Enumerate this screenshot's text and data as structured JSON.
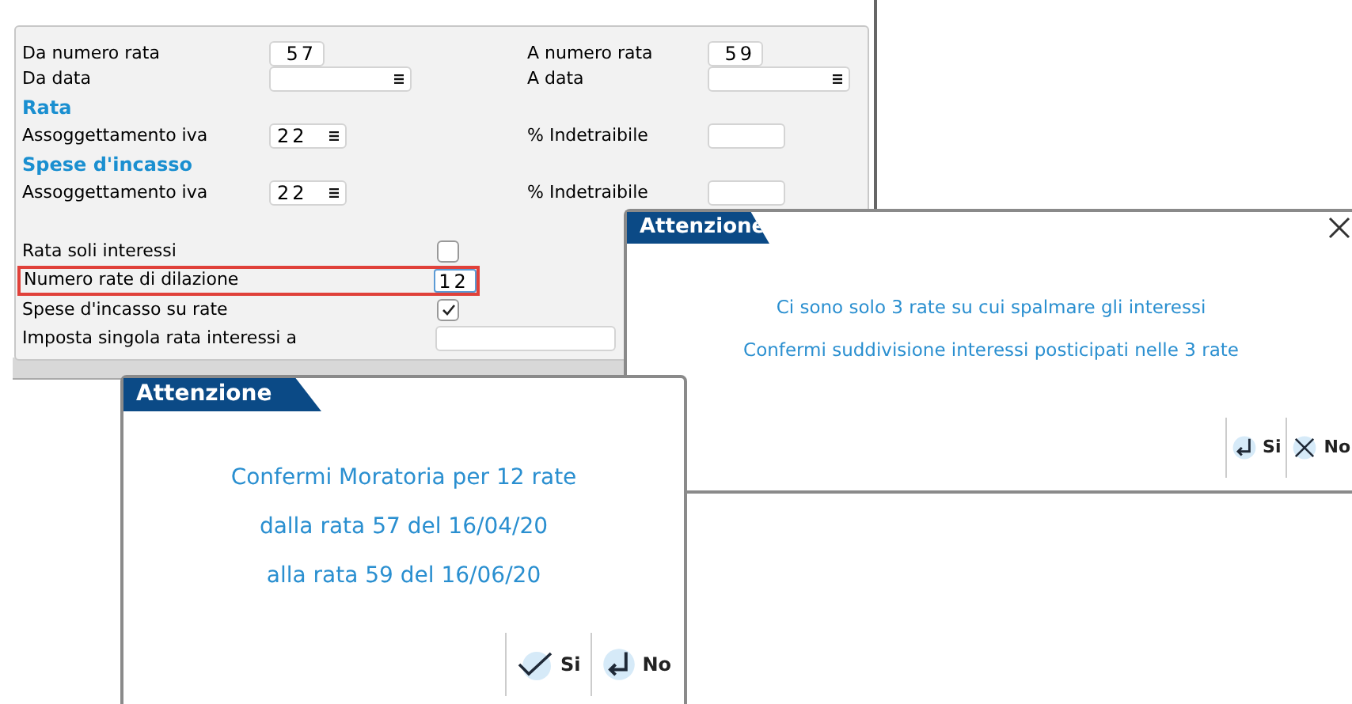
{
  "form": {
    "rows": [
      {
        "kind": "pair",
        "left": {
          "label": "Da numero rata",
          "kind": "number",
          "value": "57"
        },
        "right": {
          "label": "A numero rata",
          "kind": "number",
          "value": "59"
        }
      },
      {
        "kind": "pair",
        "left": {
          "label": "Da data",
          "kind": "date"
        },
        "right": {
          "label": "A data",
          "kind": "date"
        }
      },
      {
        "kind": "section",
        "label": "Rata"
      },
      {
        "kind": "pair",
        "left": {
          "label": "Assoggettamento iva",
          "kind": "select",
          "value": "22"
        },
        "right": {
          "label": "% Indetraibile",
          "kind": "short"
        }
      },
      {
        "kind": "section",
        "label": "Spese d'incasso"
      },
      {
        "kind": "pair",
        "left": {
          "label": "Assoggettamento iva",
          "kind": "select",
          "value": "22"
        },
        "right": {
          "label": "% Indetraibile",
          "kind": "short"
        }
      },
      {
        "kind": "spacer"
      },
      {
        "kind": "checkbox",
        "label": "Rata soli interessi",
        "checked": false
      },
      {
        "kind": "number",
        "label": "Numero rate di dilazione",
        "value": "12",
        "highlighted": true
      },
      {
        "kind": "checkbox",
        "label": "Spese d'incasso su rate",
        "checked": true
      },
      {
        "kind": "text",
        "label": "Imposta singola rata interessi a"
      }
    ]
  },
  "dialogs": [
    {
      "title": "Attenzione",
      "closable": true,
      "lines": [
        "Ci sono solo 3 rate su cui spalmare gli interessi",
        "Confermi suddivisione interessi posticipati nelle 3 rate"
      ],
      "buttons": [
        {
          "label": "Si",
          "kind": "enter"
        },
        {
          "label": "No",
          "kind": "close"
        }
      ]
    },
    {
      "title": "Attenzione",
      "closable": false,
      "lines": [
        "Confermi Moratoria per 12 rate",
        "dalla rata 57 del 16/04/20",
        "alla rata 59 del 16/06/20"
      ],
      "buttons": [
        {
          "label": "Si",
          "kind": "check"
        },
        {
          "label": "No",
          "kind": "enter"
        }
      ]
    }
  ]
}
